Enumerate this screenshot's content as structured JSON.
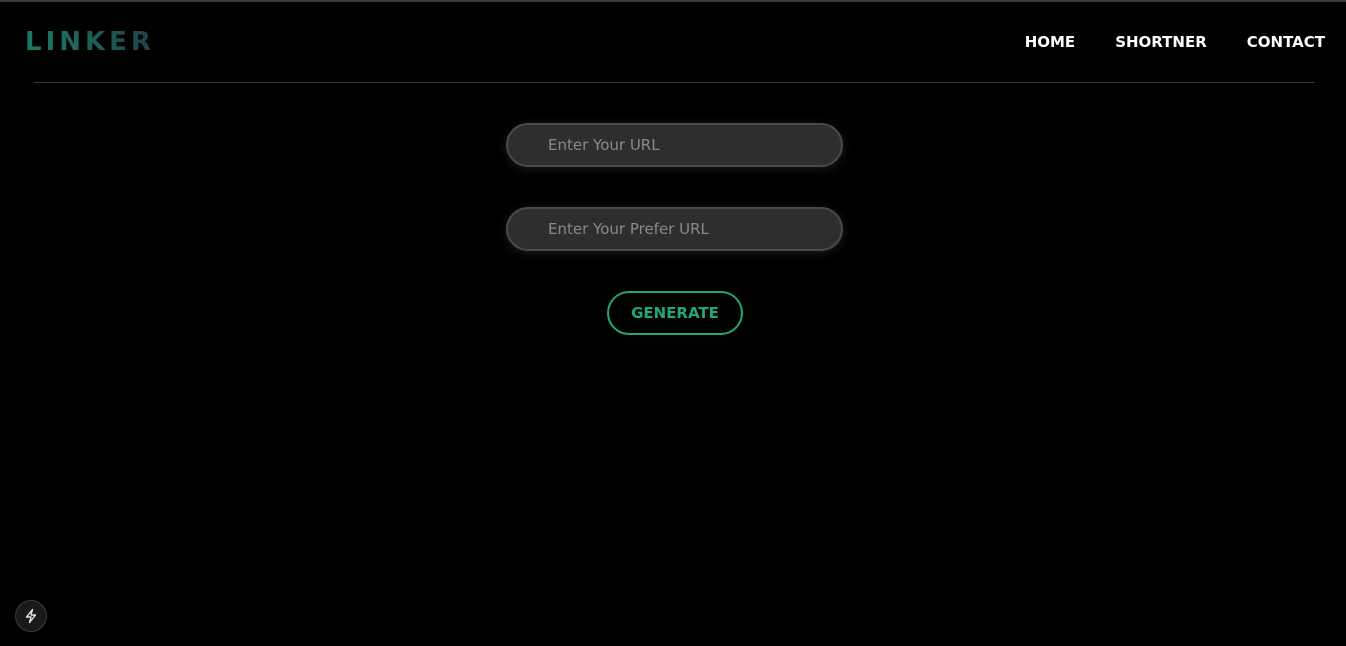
{
  "brand": {
    "logo_text": "LINKER"
  },
  "nav": {
    "items": [
      {
        "label": "HOME"
      },
      {
        "label": "SHORTNER"
      },
      {
        "label": "CONTACT"
      }
    ]
  },
  "form": {
    "url_input": {
      "placeholder": "Enter Your URL",
      "value": ""
    },
    "prefer_input": {
      "placeholder": "Enter Your Prefer URL",
      "value": ""
    },
    "generate_label": "GENERATE"
  },
  "corner_badge": {
    "icon": "lightning-icon"
  },
  "colors": {
    "background": "#000000",
    "accent": "#22a776",
    "logo_gradient": [
      "#1a7a62",
      "#1f3f4c"
    ],
    "field_bg": "#2e2e2e"
  }
}
